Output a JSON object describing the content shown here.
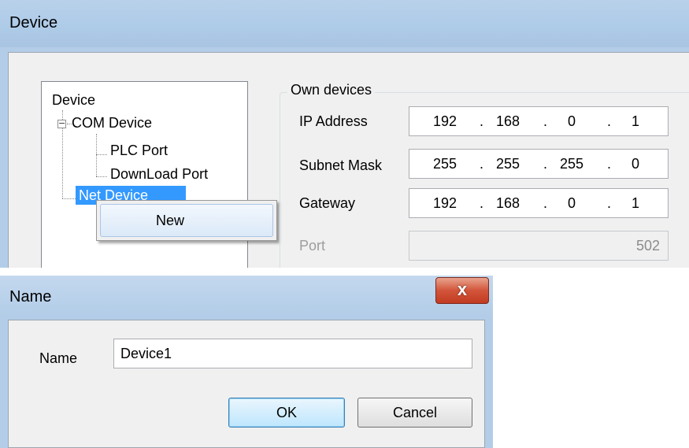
{
  "device_dialog": {
    "title": "Device",
    "tree": {
      "root": "Device",
      "com_device": "COM Device",
      "plc_port": "PLC Port",
      "download_port": "DownLoad Port",
      "net_device": "Net Device"
    },
    "context_menu": {
      "new_label": "New"
    },
    "own_devices": {
      "group_label": "Own devices",
      "ip_address": {
        "label": "IP Address",
        "octets": [
          "192",
          "168",
          "0",
          "1"
        ]
      },
      "subnet_mask": {
        "label": "Subnet Mask",
        "octets": [
          "255",
          "255",
          "255",
          "0"
        ]
      },
      "gateway": {
        "label": "Gateway",
        "octets": [
          "192",
          "168",
          "0",
          "1"
        ]
      },
      "port": {
        "label": "Port",
        "value": "502"
      }
    }
  },
  "name_dialog": {
    "title": "Name",
    "close_glyph": "x",
    "name_label": "Name",
    "name_value": "Device1",
    "ok_label": "OK",
    "cancel_label": "Cancel"
  },
  "colors": {
    "titlebar": "#b9d1ea",
    "selection": "#3399ff",
    "close_button": "#c13b21"
  }
}
